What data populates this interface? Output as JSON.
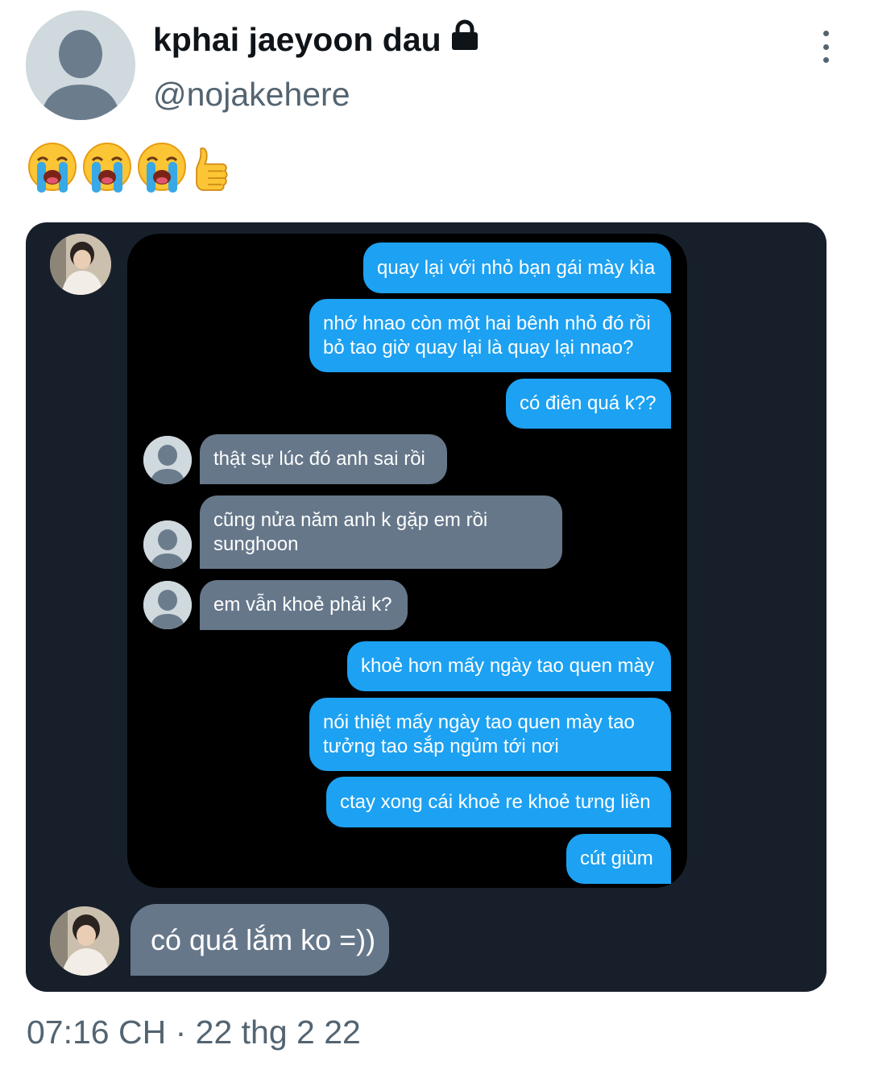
{
  "tweet": {
    "display_name": "kphai jaeyoon dau",
    "handle": "@nojakehere",
    "emojis": [
      "loudly-crying-face",
      "loudly-crying-face",
      "loudly-crying-face",
      "thumbs-up"
    ],
    "timestamp": "07:16 CH · 22 thg 2 22"
  },
  "chat": {
    "messages": [
      {
        "side": "out",
        "text": "quay lại với nhỏ bạn gái mày kìa"
      },
      {
        "side": "out",
        "text": "nhớ hnao còn một hai bênh nhỏ đó rồi\nbỏ tao giờ quay lại là quay lại nnao?"
      },
      {
        "side": "out",
        "text": "có điên quá k??"
      },
      {
        "side": "in",
        "text": "thật sự lúc đó anh sai rồi"
      },
      {
        "side": "in",
        "text": "cũng nửa năm anh k gặp em rồi\nsunghoon"
      },
      {
        "side": "in",
        "text": "em vẫn khoẻ phải k?"
      },
      {
        "side": "out",
        "text": "khoẻ hơn mấy ngày tao quen mày"
      },
      {
        "side": "out",
        "text": "nói thiệt mấy ngày tao quen mày tao\ntưởng tao sắp ngủm tới nơi"
      },
      {
        "side": "out",
        "text": "ctay xong cái khoẻ re khoẻ tưng liền"
      },
      {
        "side": "out",
        "text": "cút giùm"
      }
    ],
    "reply": "có quá lắm ko =))"
  },
  "colors": {
    "outgoing_bubble": "#1da1f2",
    "incoming_bubble": "#66778a",
    "media_background": "#17202a",
    "secondary_text": "#536471"
  }
}
